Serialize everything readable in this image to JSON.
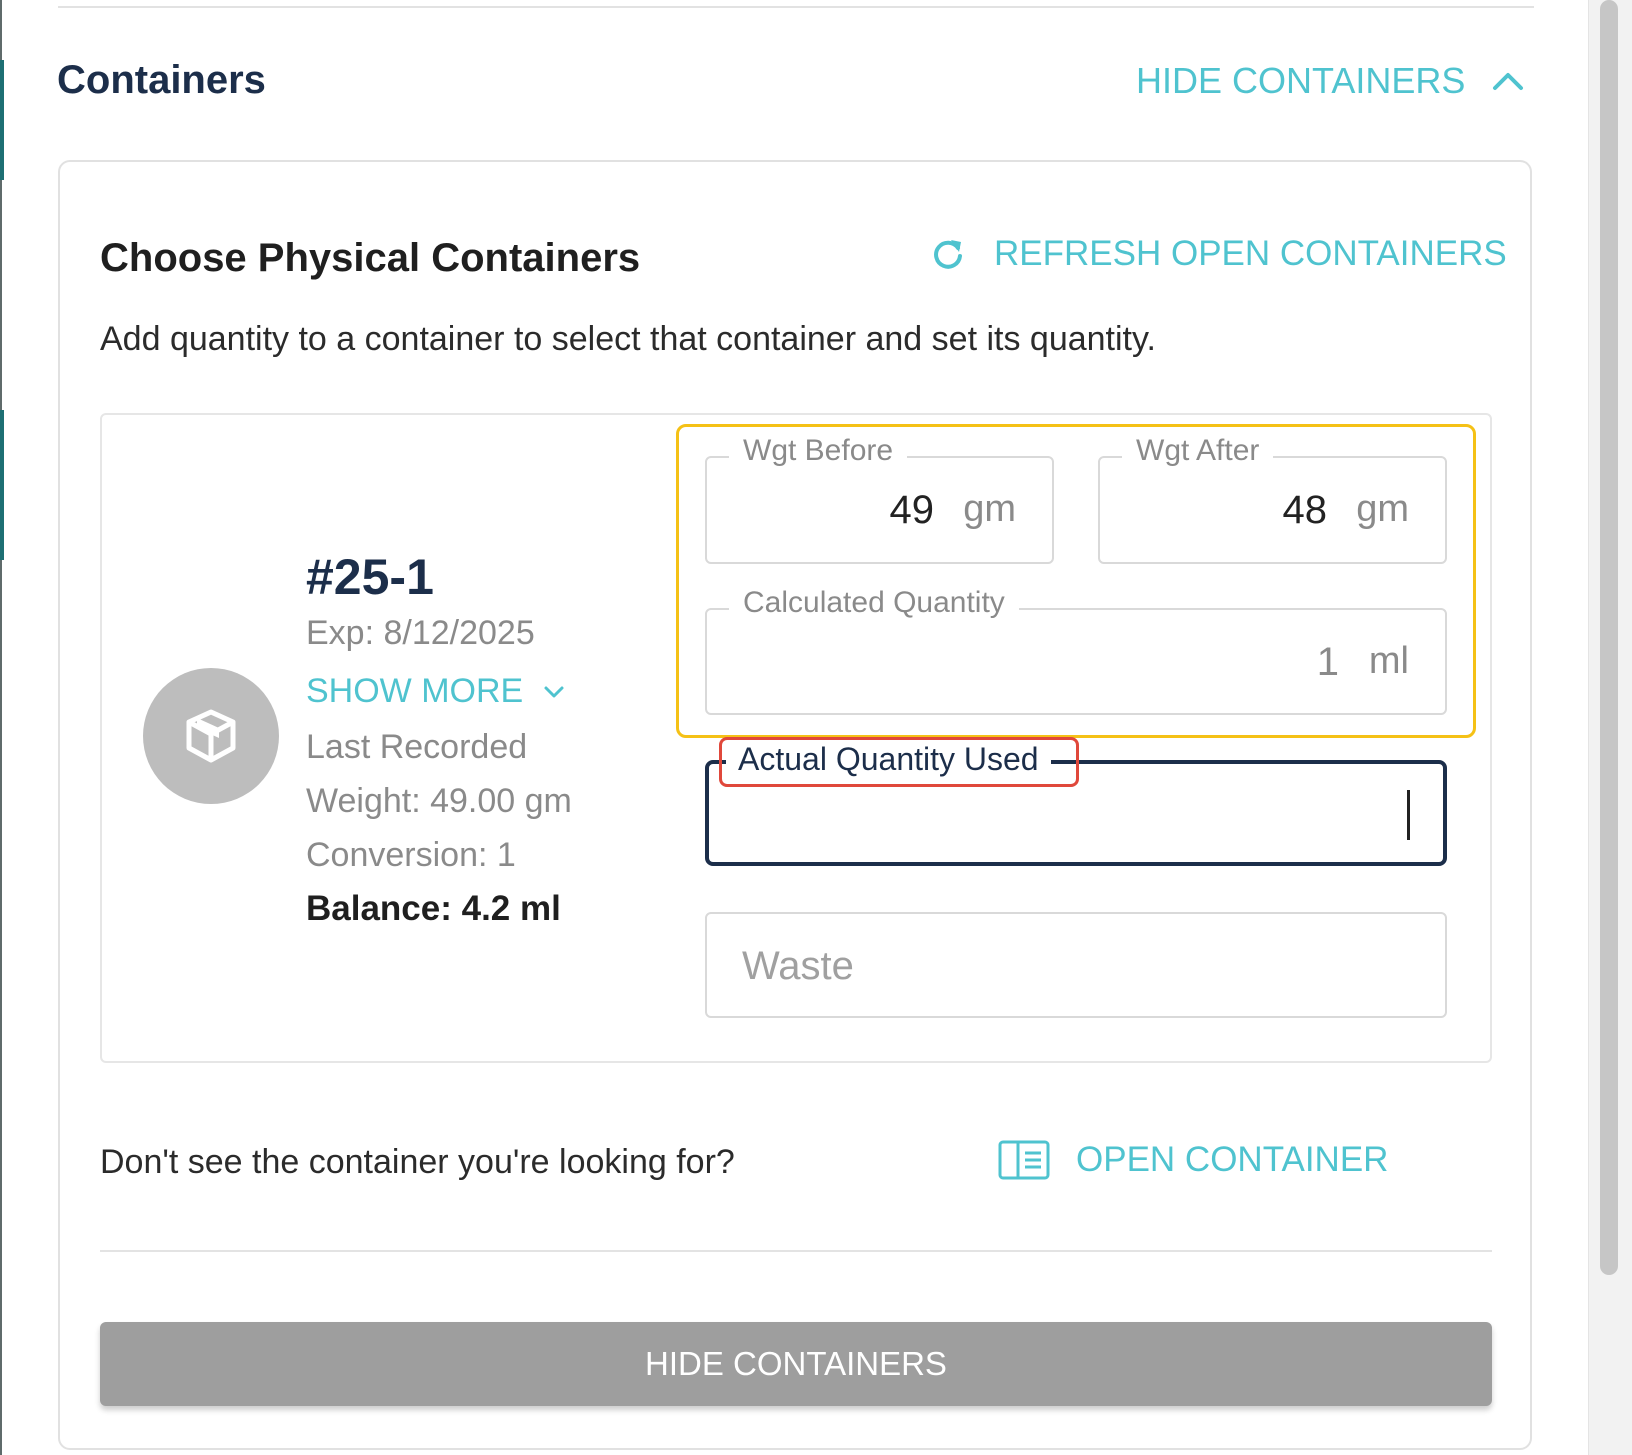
{
  "section": {
    "title": "Containers",
    "hide_link": "HIDE CONTAINERS"
  },
  "card": {
    "title": "Choose Physical Containers",
    "refresh_label": "REFRESH OPEN CONTAINERS",
    "description": "Add quantity to a container to select that container and set its quantity."
  },
  "container": {
    "id": "#25-1",
    "expiry": "Exp: 8/12/2025",
    "show_more": "SHOW MORE",
    "last_recorded": "Last Recorded",
    "weight": "Weight: 49.00 gm",
    "conversion": "Conversion: 1",
    "balance": "Balance: 4.2 ml",
    "icon": "box-icon"
  },
  "fields": {
    "wgt_before": {
      "label": "Wgt Before",
      "value": "49",
      "unit": "gm"
    },
    "wgt_after": {
      "label": "Wgt After",
      "value": "48",
      "unit": "gm"
    },
    "calculated": {
      "label": "Calculated Quantity",
      "value": "1",
      "unit": "ml"
    },
    "actual": {
      "label": "Actual Quantity Used",
      "value": ""
    },
    "waste": {
      "placeholder": "Waste",
      "value": ""
    }
  },
  "footer": {
    "prompt": "Don't see the container you're looking for?",
    "open_label": "OPEN CONTAINER",
    "hide_button": "HIDE CONTAINERS"
  },
  "colors": {
    "accent": "#4fc3cf",
    "title": "#1c2e4a",
    "highlight_yellow": "#f5c116",
    "highlight_red": "#e0483b",
    "button_gray": "#9e9e9e"
  }
}
